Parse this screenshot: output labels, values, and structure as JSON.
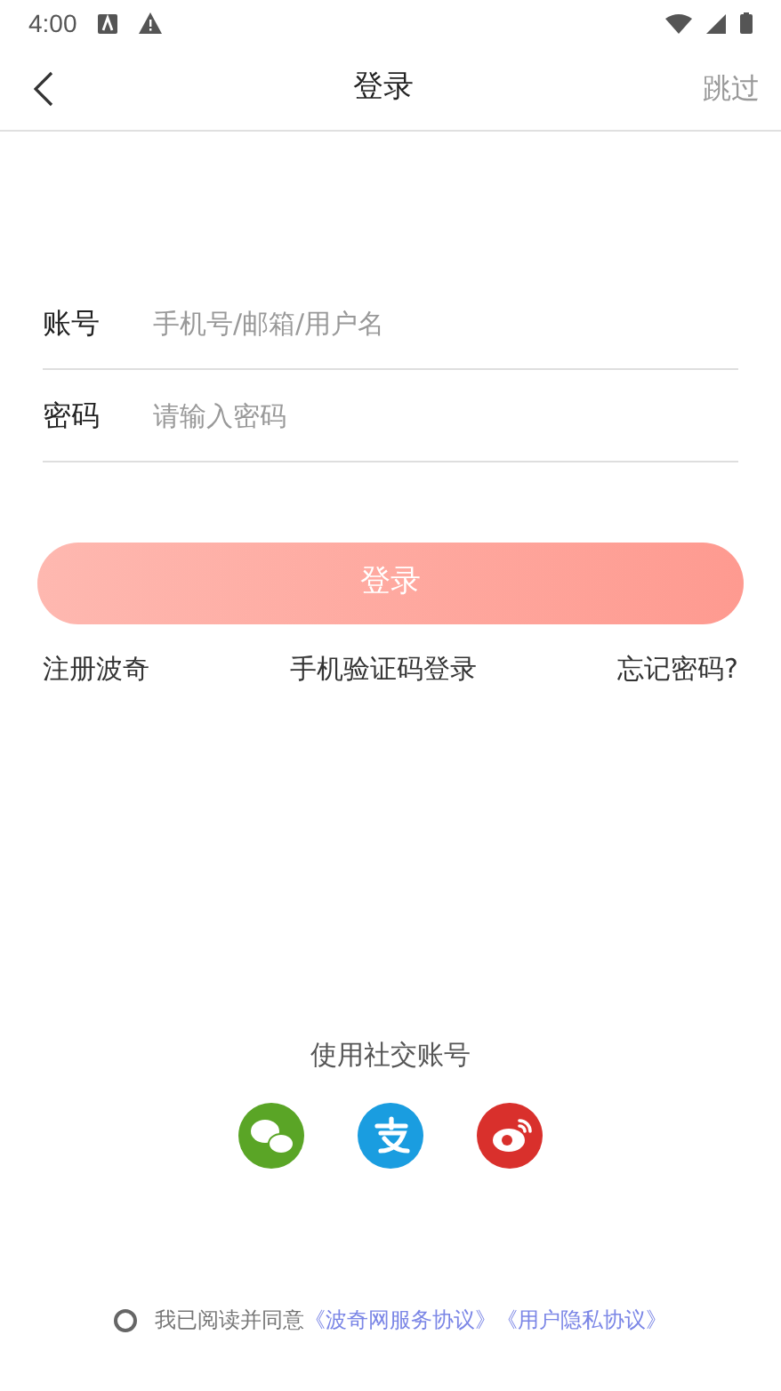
{
  "status_bar": {
    "time": "4:00"
  },
  "header": {
    "title": "登录",
    "skip": "跳过"
  },
  "fields": [
    {
      "label": "账号",
      "placeholder": "手机号/邮箱/用户名"
    },
    {
      "label": "密码",
      "placeholder": "请输入密码"
    }
  ],
  "login_button": {
    "label": "登录",
    "disabled": true
  },
  "links": [
    "注册波奇",
    "手机验证码登录",
    "忘记密码?"
  ],
  "social": {
    "title": "使用社交账号",
    "accounts": [
      {
        "kind": "wechat",
        "color": "#5aa526"
      },
      {
        "kind": "alipay",
        "color": "#1a9de0"
      },
      {
        "kind": "weibo",
        "color": "#d9302c"
      }
    ]
  },
  "agreement": {
    "checked": false,
    "text": "我已阅读并同意",
    "links": [
      "《波奇网服务协议》",
      "《用户隐私协议》"
    ]
  }
}
